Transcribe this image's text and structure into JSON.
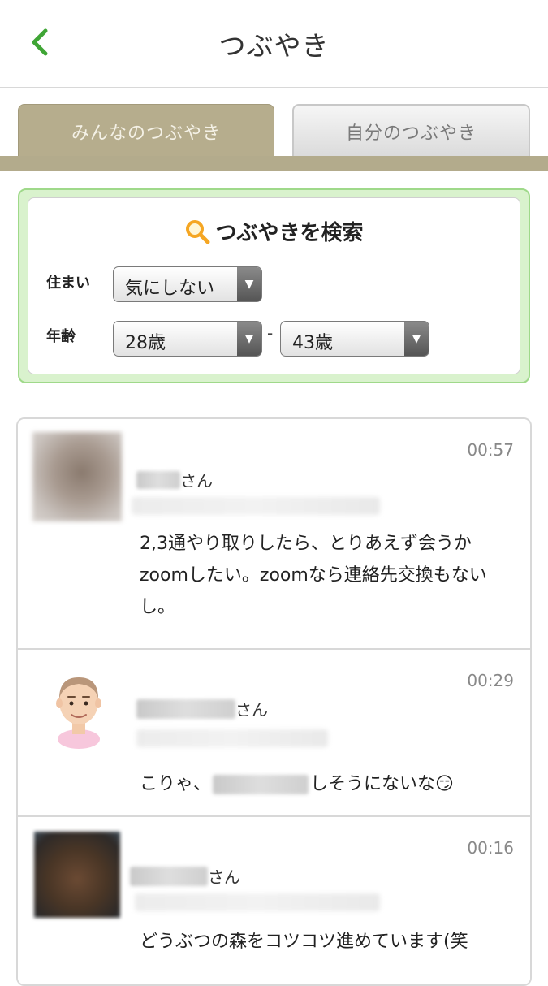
{
  "header": {
    "title": "つぶやき"
  },
  "tabs": [
    {
      "label": "みんなのつぶやき",
      "active": true
    },
    {
      "label": "自分のつぶやき",
      "active": false
    }
  ],
  "search": {
    "title": "つぶやきを検索",
    "residence_label": "住まい",
    "residence_value": "気にしない",
    "age_label": "年齢",
    "age_min": "28歳",
    "age_separator": "-",
    "age_max": "43歳"
  },
  "posts": [
    {
      "time": "00:57",
      "name_suffix": "さん",
      "text": "2,3通やり取りしたら、とりあえず会うかzoomしたい。zoomなら連絡先交換もないし。"
    },
    {
      "time": "00:29",
      "name_suffix": "さん",
      "text_before": "こりゃ、",
      "text_after": "しそうにないな😏"
    },
    {
      "time": "00:16",
      "name_suffix": "さん",
      "text": "どうぶつの森をコツコツ進めています(笑"
    }
  ],
  "colors": {
    "accent_green": "#3fa535",
    "tab_active_bg": "#b6ad8d",
    "search_border": "#9fd98a"
  }
}
